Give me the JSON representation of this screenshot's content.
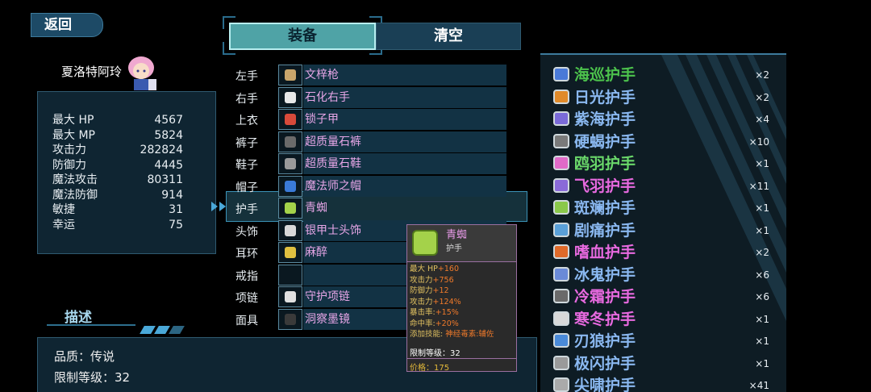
{
  "back_label": "返回",
  "character": {
    "name": "夏洛特阿玲"
  },
  "stats": [
    {
      "label": "最大 HP",
      "value": "4567"
    },
    {
      "label": "最大 MP",
      "value": "5824"
    },
    {
      "label": "攻击力",
      "value": "282824"
    },
    {
      "label": "防御力",
      "value": "4445"
    },
    {
      "label": "魔法攻击",
      "value": "80311"
    },
    {
      "label": "魔法防御",
      "value": "914"
    },
    {
      "label": "敏捷",
      "value": "31"
    },
    {
      "label": "幸运",
      "value": "75"
    }
  ],
  "description": {
    "title": "描述",
    "quality": "品质：传说",
    "level": "限制等级：32"
  },
  "tabs": {
    "equip": "装备",
    "clear": "清空"
  },
  "slots": [
    {
      "slot": "左手",
      "item": "文梓枪",
      "icon_color": "#c9a56b"
    },
    {
      "slot": "右手",
      "item": "石化右手",
      "icon_color": "#e8e8e8"
    },
    {
      "slot": "上衣",
      "item": "锁子甲",
      "icon_color": "#d84a3a"
    },
    {
      "slot": "裤子",
      "item": "超质量石裤",
      "icon_color": "#6a6a6a"
    },
    {
      "slot": "鞋子",
      "item": "超质量石鞋",
      "icon_color": "#9a9a9a"
    },
    {
      "slot": "帽子",
      "item": "魔法师之帽",
      "icon_color": "#3a7ad8"
    },
    {
      "slot": "护手",
      "item": "青蜘",
      "icon_color": "#a4d24a"
    },
    {
      "slot": "头饰",
      "item": "银甲士头饰",
      "icon_color": "#d8d8d8"
    },
    {
      "slot": "耳环",
      "item": "麻醉",
      "icon_color": "#e0c040"
    },
    {
      "slot": "戒指",
      "item": "",
      "icon_color": ""
    },
    {
      "slot": "项链",
      "item": "守护项链",
      "icon_color": "#e0e0e0"
    },
    {
      "slot": "面具",
      "item": "洞察墨镜",
      "icon_color": "#3a3a3a"
    }
  ],
  "tooltip": {
    "name": "青蜘",
    "type": "护手",
    "stats": [
      {
        "label": "最大 HP",
        "value": "+160"
      },
      {
        "label": "攻击力",
        "value": "+756"
      },
      {
        "label": "防御力",
        "value": "+12"
      },
      {
        "label": "攻击力",
        "value": "+124%"
      },
      {
        "label": "暴击率:",
        "value": "+15%"
      },
      {
        "label": "命中率:",
        "value": "+20%"
      },
      {
        "label": "添加技能: ",
        "value": "神经毒素:辅佐"
      }
    ],
    "level": "限制等级：32",
    "price": "价格：175"
  },
  "inventory": [
    {
      "name": "海巡护手",
      "count": "×2",
      "color": "#4cc24c",
      "icon": "#4a7ad8"
    },
    {
      "name": "日光护手",
      "count": "×2",
      "color": "#8ab8f0",
      "icon": "#e08a2a"
    },
    {
      "name": "紫海护手",
      "count": "×4",
      "color": "#8ab8f0",
      "icon": "#7a6ad8"
    },
    {
      "name": "硬蝎护手",
      "count": "×10",
      "color": "#8ab8f0",
      "icon": "#7a7a7a"
    },
    {
      "name": "鸥羽护手",
      "count": "×1",
      "color": "#6ad86a",
      "icon": "#e06ac8"
    },
    {
      "name": "飞羽护手",
      "count": "×11",
      "color": "#e86ae0",
      "icon": "#8a6ad8"
    },
    {
      "name": "斑斓护手",
      "count": "×1",
      "color": "#8ab8f0",
      "icon": "#8ac84a"
    },
    {
      "name": "剧痛护手",
      "count": "×1",
      "color": "#8ab8f0",
      "icon": "#5aa0d8"
    },
    {
      "name": "嗜血护手",
      "count": "×2",
      "color": "#e86ae0",
      "icon": "#e06a2a"
    },
    {
      "name": "冰鬼护手",
      "count": "×6",
      "color": "#8ab8f0",
      "icon": "#6a8ad8"
    },
    {
      "name": "冷霜护手",
      "count": "×6",
      "color": "#e86ae0",
      "icon": "#6a6a6a"
    },
    {
      "name": "寒冬护手",
      "count": "×1",
      "color": "#e86ae0",
      "icon": "#d8d8d8"
    },
    {
      "name": "刃狼护手",
      "count": "×1",
      "color": "#8ab8f0",
      "icon": "#4a8ad8"
    },
    {
      "name": "极闪护手",
      "count": "×1",
      "color": "#8ab8f0",
      "icon": "#9a9a9a"
    },
    {
      "name": "尖啸护手",
      "count": "×41",
      "color": "#8ab8f0",
      "icon": "#aaaaaa"
    }
  ]
}
